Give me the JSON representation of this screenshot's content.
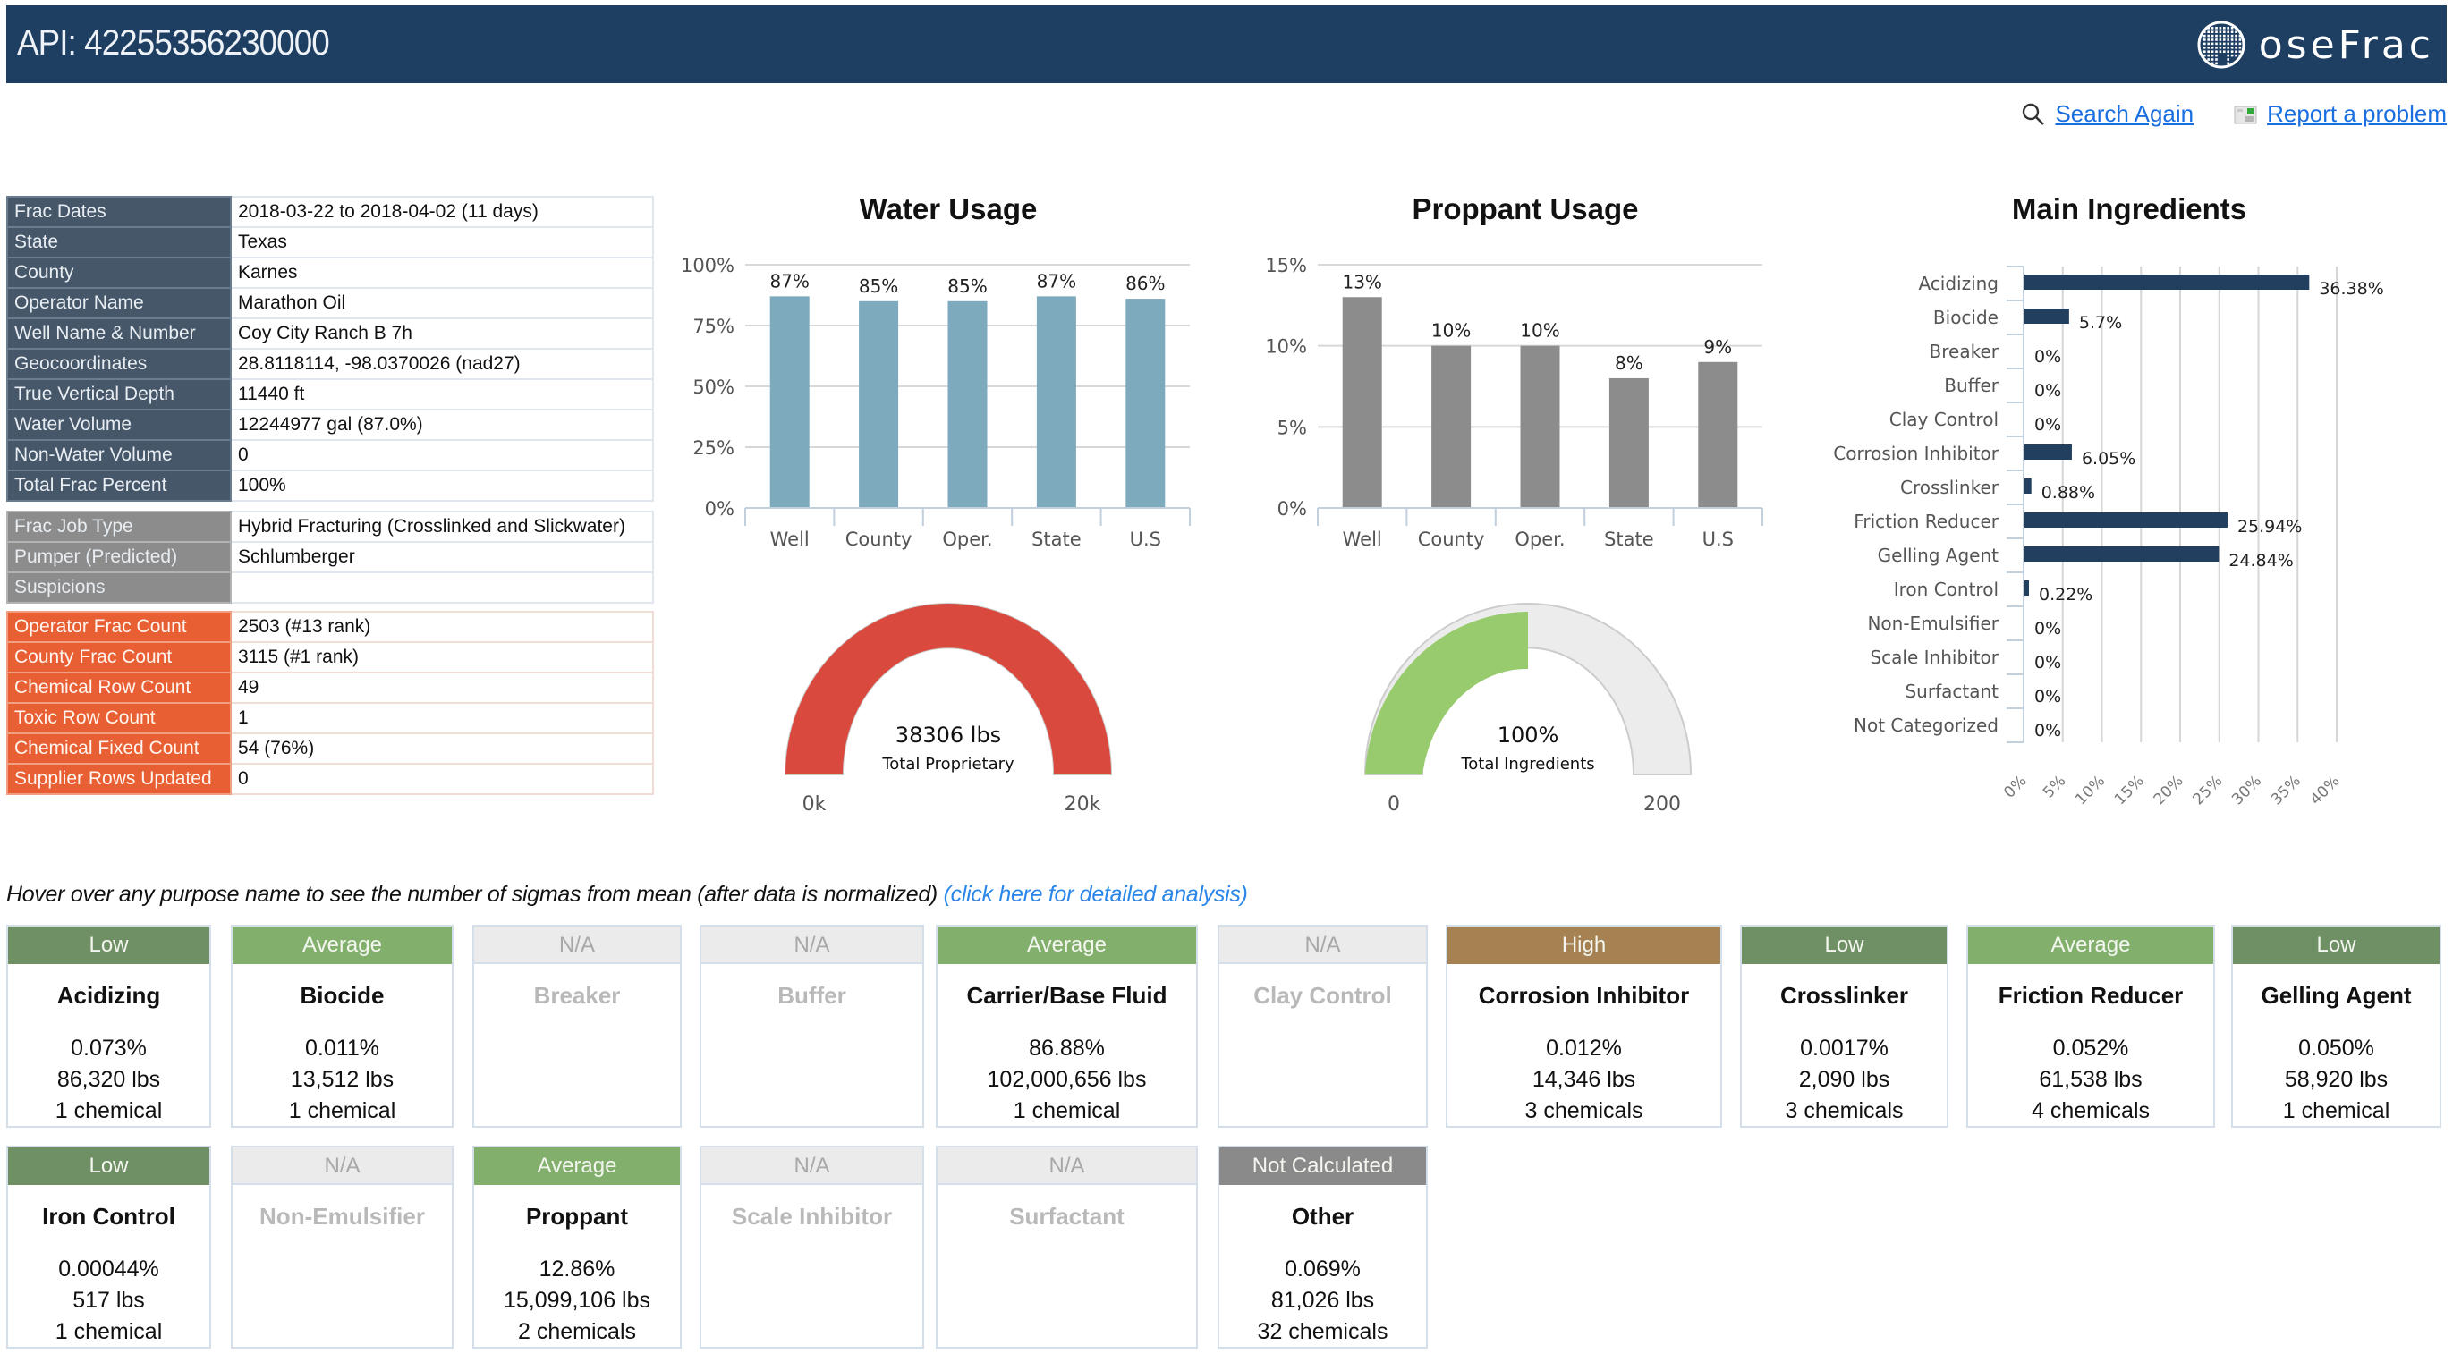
{
  "header": {
    "title": "API: 42255356230000",
    "logo_text": "oseFrac",
    "logo_icon": "globe-icon"
  },
  "links": {
    "search_again": "Search Again",
    "search_icon": "search-icon",
    "report_problem": "Report a problem",
    "report_icon": "report-icon"
  },
  "well_info": [
    {
      "label": "Frac Dates",
      "value": "2018-03-22 to 2018-04-02 (11 days)"
    },
    {
      "label": "State",
      "value": "Texas"
    },
    {
      "label": "County",
      "value": "Karnes"
    },
    {
      "label": "Operator Name",
      "value": "Marathon Oil"
    },
    {
      "label": "Well Name & Number",
      "value": "Coy City Ranch B 7h"
    },
    {
      "label": "Geocoordinates",
      "value": "28.8118114, -98.0370026 (nad27)"
    },
    {
      "label": "True Vertical Depth",
      "value": "11440 ft"
    },
    {
      "label": "Water Volume",
      "value": "12244977 gal (87.0%)"
    },
    {
      "label": "Non-Water Volume",
      "value": "0"
    },
    {
      "label": "Total Frac Percent",
      "value": "100%"
    }
  ],
  "job_info": [
    {
      "label": "Frac Job Type",
      "value": "Hybrid Fracturing (Crosslinked and Slickwater)"
    },
    {
      "label": "Pumper (Predicted)",
      "value": "Schlumberger"
    },
    {
      "label": "Suspicions",
      "value": ""
    }
  ],
  "count_info": [
    {
      "label": "Operator Frac Count",
      "value": "2503 (#13 rank)"
    },
    {
      "label": "County Frac Count",
      "value": "3115 (#1 rank)"
    },
    {
      "label": "Chemical Row Count",
      "value": "49"
    },
    {
      "label": "Toxic Row Count",
      "value": "1"
    },
    {
      "label": "Chemical Fixed Count",
      "value": "54 (76%)"
    },
    {
      "label": "Supplier Rows Updated",
      "value": "0"
    }
  ],
  "chart_data": [
    {
      "id": "water",
      "type": "bar",
      "title": "Water Usage",
      "categories": [
        "Well",
        "County",
        "Oper.",
        "State",
        "U.S"
      ],
      "values": [
        87,
        85,
        85,
        87,
        86
      ],
      "data_labels": [
        "87%",
        "85%",
        "85%",
        "87%",
        "86%"
      ],
      "ylim": [
        0,
        100
      ],
      "yticks": [
        0,
        25,
        50,
        75,
        100
      ],
      "ytick_labels": [
        "0%",
        "25%",
        "50%",
        "75%",
        "100%"
      ],
      "xlabel": "",
      "ylabel": "",
      "grid": true,
      "color": "#7eaabd"
    },
    {
      "id": "proppant",
      "type": "bar",
      "title": "Proppant Usage",
      "categories": [
        "Well",
        "County",
        "Oper.",
        "State",
        "U.S"
      ],
      "values": [
        13,
        10,
        10,
        8,
        9
      ],
      "data_labels": [
        "13%",
        "10%",
        "10%",
        "8%",
        "9%"
      ],
      "ylim": [
        0,
        15
      ],
      "yticks": [
        0,
        5,
        10,
        15
      ],
      "ytick_labels": [
        "0%",
        "5%",
        "10%",
        "15%"
      ],
      "xlabel": "",
      "ylabel": "",
      "grid": true,
      "color": "#8c8c8c"
    },
    {
      "id": "ingredients",
      "type": "bar",
      "orientation": "horizontal",
      "title": "Main Ingredients",
      "categories": [
        "Acidizing",
        "Biocide",
        "Breaker",
        "Buffer",
        "Clay Control",
        "Corrosion Inhibitor",
        "Crosslinker",
        "Friction Reducer",
        "Gelling Agent",
        "Iron Control",
        "Non-Emulsifier",
        "Scale Inhibitor",
        "Surfactant",
        "Not Categorized"
      ],
      "values": [
        36.38,
        5.7,
        0,
        0,
        0,
        6.05,
        0.88,
        25.94,
        24.84,
        0.22,
        0,
        0,
        0,
        0
      ],
      "data_labels": [
        "36.38%",
        "5.7%",
        "0%",
        "0%",
        "0%",
        "6.05%",
        "0.88%",
        "25.94%",
        "24.84%",
        "0.22%",
        "0%",
        "0%",
        "0%",
        "0%"
      ],
      "xlim": [
        0,
        40
      ],
      "xticks": [
        0,
        5,
        10,
        15,
        20,
        25,
        30,
        35,
        40
      ],
      "xtick_labels": [
        "0%",
        "5%",
        "10%",
        "15%",
        "20%",
        "25%",
        "30%",
        "35%",
        "40%"
      ],
      "xlabel": "",
      "ylabel": "",
      "grid": true,
      "color": "#233f60"
    }
  ],
  "gauges": [
    {
      "id": "proprietary",
      "value": 38306,
      "min": 0,
      "max": 20000,
      "value_label": "38306 lbs",
      "caption": "Total Proprietary",
      "min_label": "0k",
      "max_label": "20k",
      "color": "#d9493e"
    },
    {
      "id": "ingredients",
      "value": 100,
      "min": 0,
      "max": 200,
      "value_label": "100%",
      "caption": "Total Ingredients",
      "min_label": "0",
      "max_label": "200",
      "color": "#98cb6e"
    }
  ],
  "hint": {
    "text": "Hover over any purpose name to see the number of sigmas from mean (after data is normalized)",
    "link": "(click here for detailed analysis)"
  },
  "status_colors": {
    "Low": "#6f8f65",
    "Average": "#82b06c",
    "High": "#a68253",
    "N/A": "#ebebeb",
    "Not Calculated": "#8a8a8a"
  },
  "purposes": [
    {
      "status": "Low",
      "name": "Acidizing",
      "percent": "0.073%",
      "mass": "86,320 lbs",
      "chemicals": "1 chemical"
    },
    {
      "status": "Average",
      "name": "Biocide",
      "percent": "0.011%",
      "mass": "13,512 lbs",
      "chemicals": "1 chemical"
    },
    {
      "status": "N/A",
      "name": "Breaker",
      "percent": "",
      "mass": "",
      "chemicals": ""
    },
    {
      "status": "N/A",
      "name": "Buffer",
      "percent": "",
      "mass": "",
      "chemicals": ""
    },
    {
      "status": "Average",
      "name": "Carrier/Base Fluid",
      "percent": "86.88%",
      "mass": "102,000,656 lbs",
      "chemicals": "1 chemical"
    },
    {
      "status": "N/A",
      "name": "Clay Control",
      "percent": "",
      "mass": "",
      "chemicals": ""
    },
    {
      "status": "High",
      "name": "Corrosion Inhibitor",
      "percent": "0.012%",
      "mass": "14,346 lbs",
      "chemicals": "3 chemicals"
    },
    {
      "status": "Low",
      "name": "Crosslinker",
      "percent": "0.0017%",
      "mass": "2,090 lbs",
      "chemicals": "3 chemicals"
    },
    {
      "status": "Average",
      "name": "Friction Reducer",
      "percent": "0.052%",
      "mass": "61,538 lbs",
      "chemicals": "4 chemicals"
    },
    {
      "status": "Low",
      "name": "Gelling Agent",
      "percent": "0.050%",
      "mass": "58,920 lbs",
      "chemicals": "1 chemical"
    },
    {
      "status": "Low",
      "name": "Iron Control",
      "percent": "0.00044%",
      "mass": "517 lbs",
      "chemicals": "1 chemical"
    },
    {
      "status": "N/A",
      "name": "Non-Emulsifier",
      "percent": "",
      "mass": "",
      "chemicals": ""
    },
    {
      "status": "Average",
      "name": "Proppant",
      "percent": "12.86%",
      "mass": "15,099,106 lbs",
      "chemicals": "2 chemicals"
    },
    {
      "status": "N/A",
      "name": "Scale Inhibitor",
      "percent": "",
      "mass": "",
      "chemicals": ""
    },
    {
      "status": "N/A",
      "name": "Surfactant",
      "percent": "",
      "mass": "",
      "chemicals": ""
    },
    {
      "status": "Not Calculated",
      "name": "Other",
      "percent": "0.069%",
      "mass": "81,026 lbs",
      "chemicals": "32 chemicals"
    }
  ]
}
